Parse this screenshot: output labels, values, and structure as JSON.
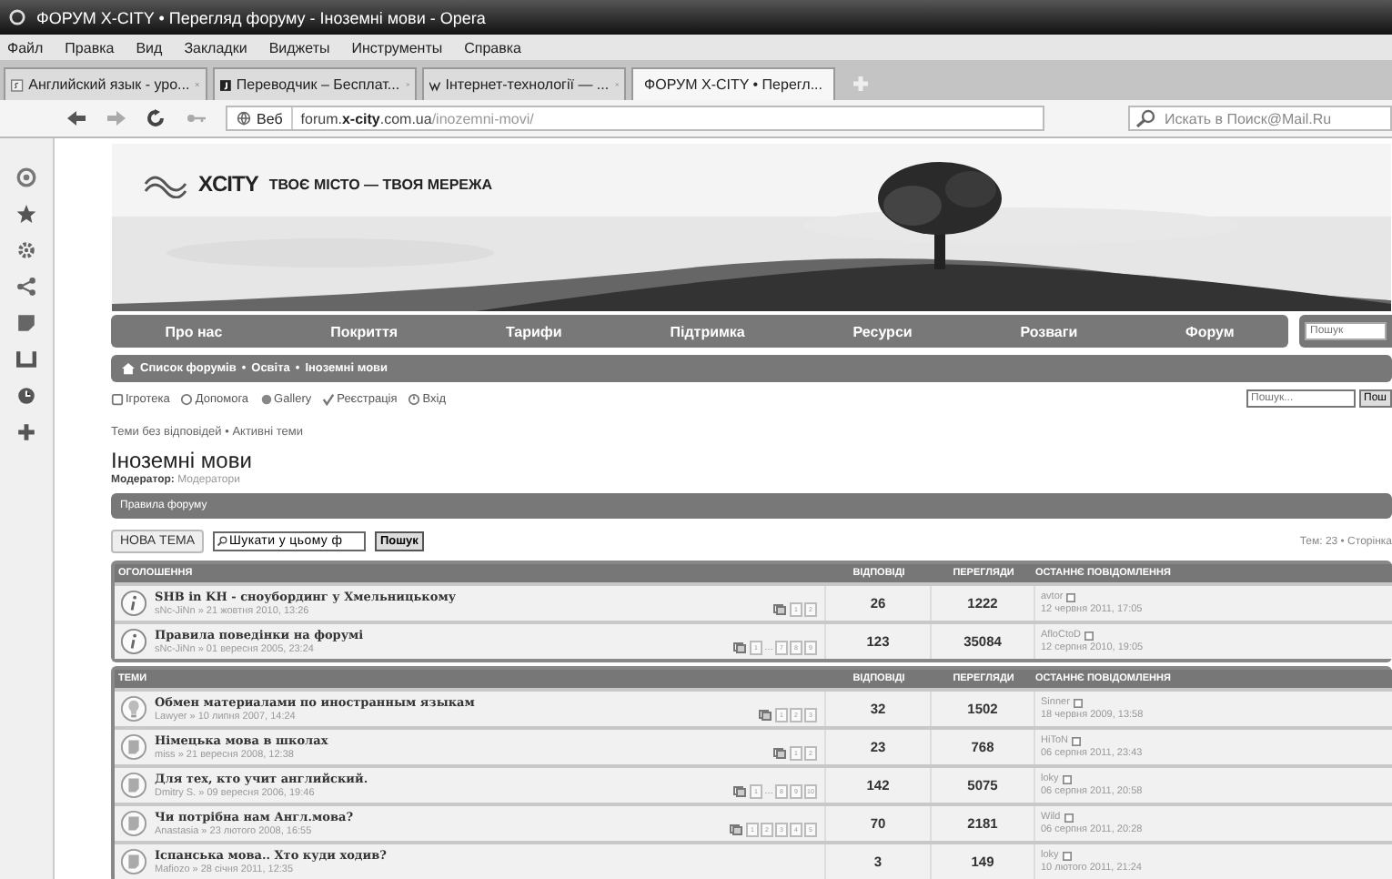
{
  "window": {
    "title": "ФОРУМ X-CITY • Перегляд форуму - Іноземні мови - Opera"
  },
  "menu": [
    "Файл",
    "Правка",
    "Вид",
    "Закладки",
    "Виджеты",
    "Инструменты",
    "Справка"
  ],
  "tabs": [
    {
      "label": "Английский язык - уро...",
      "selected": false
    },
    {
      "label": "Переводчик – Бесплат...",
      "selected": false
    },
    {
      "label": "Інтернет-технології — ...",
      "selected": false
    },
    {
      "label": "ФОРУМ X-CITY • Перегл...",
      "selected": true
    }
  ],
  "address_bar": {
    "badge": "Веб",
    "url_host": "forum.x-city.com.ua",
    "url_path": "/inozemni-movi/",
    "search_placeholder": "Искать в Поиск@Mail.Ru"
  },
  "logo": {
    "brand": "XCITY",
    "tagline": "ТВОЄ МІСТО — ТВОЯ МЕРЕЖА"
  },
  "nav": {
    "items": [
      "Про нас",
      "Покриття",
      "Тарифи",
      "Підтримка",
      "Ресурси",
      "Розваги",
      "Форум"
    ],
    "search_placeholder": "Пошук"
  },
  "breadcrumb": [
    "Список форумів",
    "Освіта",
    "Іноземні мови"
  ],
  "separator": "•",
  "links": [
    "Ігротека",
    "Допомога",
    "Gallery",
    "Реєстрація",
    "Вхід"
  ],
  "quick_search": {
    "placeholder": "Пошук...",
    "button": "Пош"
  },
  "sub_links": [
    "Теми без відповідей",
    "Активні теми"
  ],
  "forum": {
    "title": "Іноземні мови",
    "moderator_label": "Модератор:",
    "moderator": "Модератори",
    "rules": "Правила форуму"
  },
  "toolbar": {
    "new_topic": "НОВА ТЕМА",
    "search_value": "Шукати у цьому ф",
    "search_button": "Пошук",
    "stats": "Тем: 23 • Сторінка"
  },
  "sections": [
    {
      "columns": [
        "ОГОЛОШЕННЯ",
        "ВІДПОВІДІ",
        "ПЕРЕГЛЯДИ",
        "ОСТАННЄ ПОВІДОМЛЕННЯ"
      ],
      "rows": [
        {
          "kind": "announcement",
          "title": "SHB in KH - сноубординг у Хмельницькому",
          "meta": "sNc-JiNn » 21 жовтня 2010, 13:26",
          "pages": [
            "1",
            "2"
          ],
          "replies": "26",
          "views": "1222",
          "last_author": "avtor",
          "last_date": "12 червня 2011, 17:05"
        },
        {
          "kind": "announcement",
          "title": "Правила поведінки на форумі",
          "meta": "sNc-JiNn » 01 вересня 2005, 23:24",
          "pages": [
            "1",
            "…",
            "7",
            "8",
            "9"
          ],
          "replies": "123",
          "views": "35084",
          "last_author": "AfloCtoD",
          "last_date": "12 серпня 2010, 19:05"
        }
      ]
    },
    {
      "columns": [
        "ТЕМИ",
        "ВІДПОВІДІ",
        "ПЕРЕГЛЯДИ",
        "ОСТАННЄ ПОВІДОМЛЕННЯ"
      ],
      "rows": [
        {
          "kind": "hot",
          "title": "Обмен материалами по иностранным языкам",
          "meta": "Lawyer » 10 липня 2007, 14:24",
          "pages": [
            "1",
            "2",
            "3"
          ],
          "replies": "32",
          "views": "1502",
          "last_author": "Sinner",
          "last_date": "18 червня 2009, 13:58"
        },
        {
          "kind": "topic",
          "title": "Німецька мова в школах",
          "meta": "miss » 21 вересня 2008, 12:38",
          "pages": [
            "1",
            "2"
          ],
          "replies": "23",
          "views": "768",
          "last_author": "HiToN",
          "last_date": "06 серпня 2011, 23:43"
        },
        {
          "kind": "topic",
          "title": "Для тех, кто учит английский.",
          "meta": "Dmitry S. » 09 вересня 2006, 19:46",
          "pages": [
            "1",
            "…",
            "8",
            "9",
            "10"
          ],
          "replies": "142",
          "views": "5075",
          "last_author": "loky",
          "last_date": "06 серпня 2011, 20:58"
        },
        {
          "kind": "topic",
          "title": "Чи потрібна нам Англ.мова?",
          "meta": "Anastasia » 23 лютого 2008, 16:55",
          "pages": [
            "1",
            "2",
            "3",
            "4",
            "5"
          ],
          "replies": "70",
          "views": "2181",
          "last_author": "Wild",
          "last_date": "06 серпня 2011, 20:28"
        },
        {
          "kind": "topic",
          "title": "Іспанська мова.. Хто куди ходив?",
          "meta": "Mafiozo » 28 січня 2011, 12:35",
          "replies": "3",
          "views": "149",
          "last_author": "loky",
          "last_date": "10 лютого 2011, 21:24"
        }
      ]
    }
  ]
}
